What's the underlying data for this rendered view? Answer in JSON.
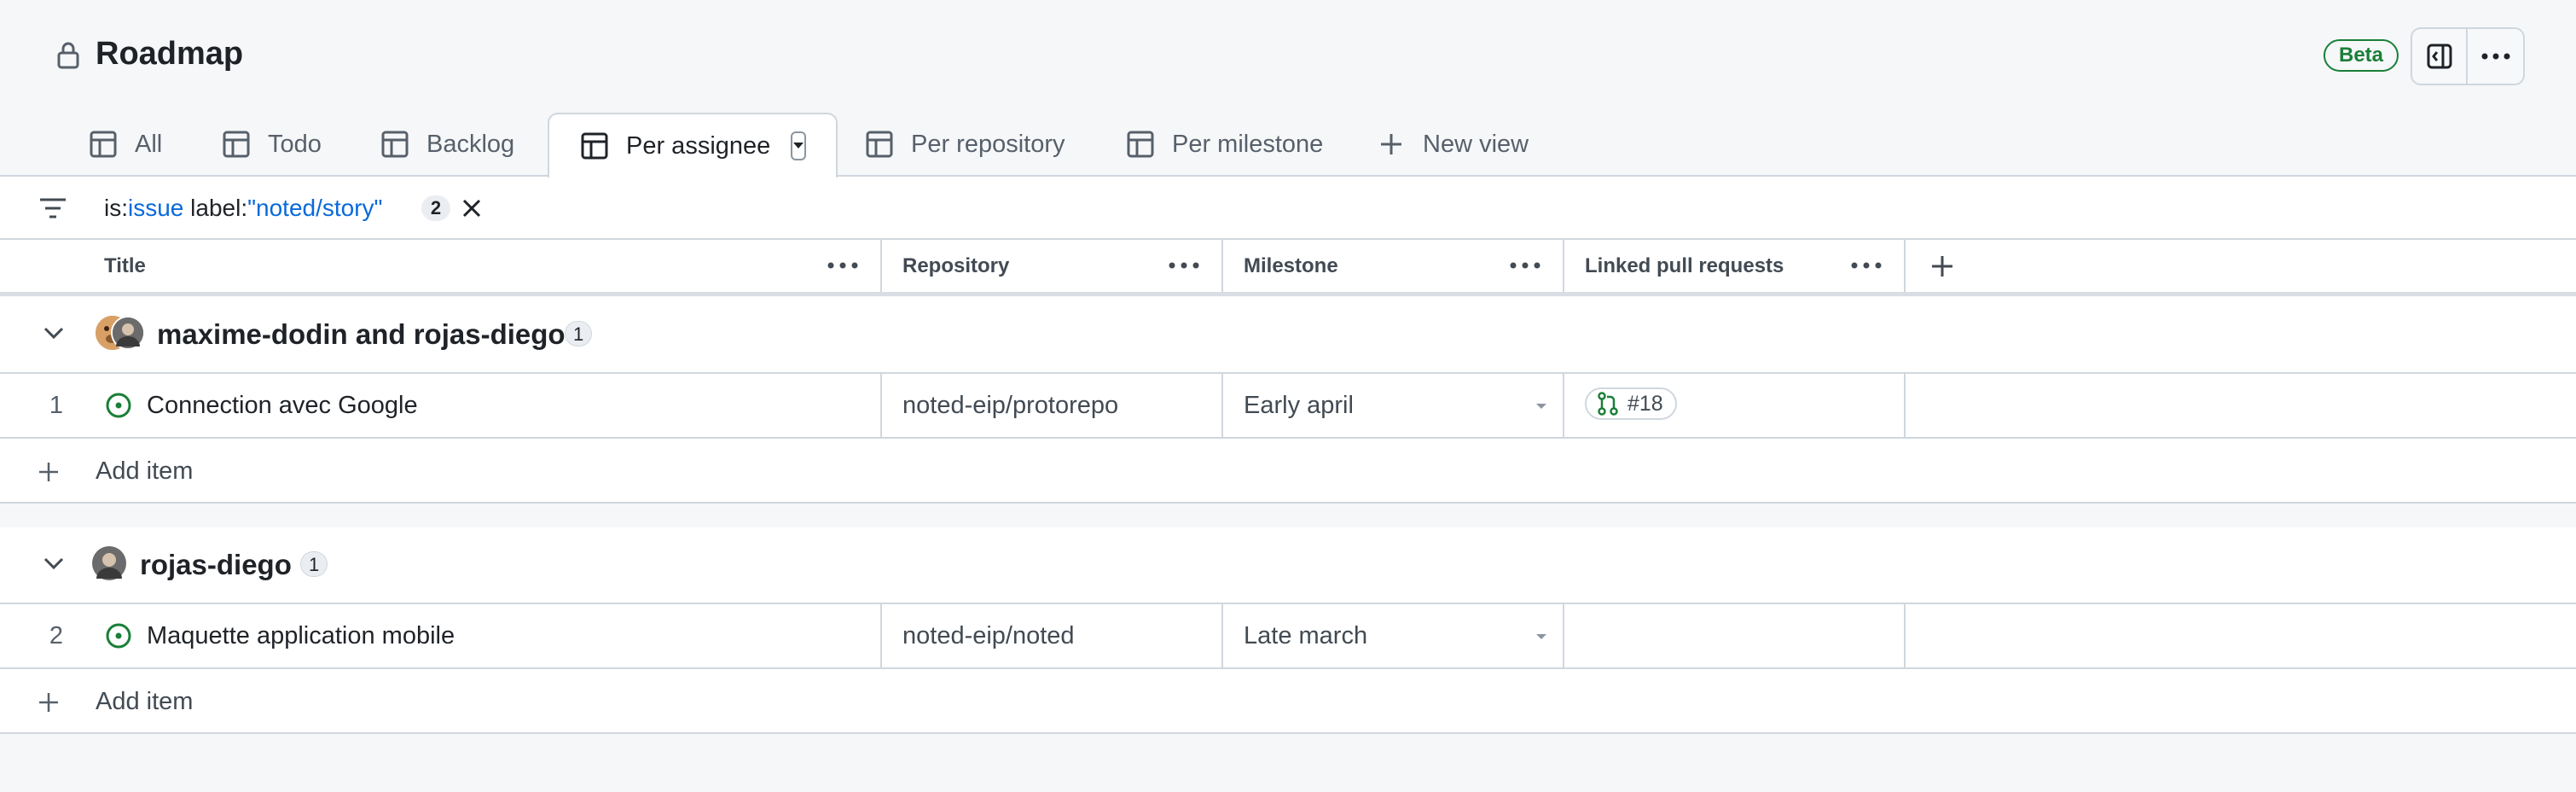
{
  "header": {
    "title": "Roadmap",
    "badge": "Beta",
    "icons": [
      "lock-icon",
      "sidebar-collapse-icon",
      "kebab-icon"
    ]
  },
  "tabs": [
    {
      "label": "All",
      "icon": "table-icon",
      "active": false
    },
    {
      "label": "Todo",
      "icon": "table-icon",
      "active": false
    },
    {
      "label": "Backlog",
      "icon": "table-icon",
      "active": false
    },
    {
      "label": "Per assignee",
      "icon": "table-icon",
      "active": true
    },
    {
      "label": "Per repository",
      "icon": "table-icon",
      "active": false
    },
    {
      "label": "Per milestone",
      "icon": "table-icon",
      "active": false
    },
    {
      "label": "New view",
      "icon": "plus-icon",
      "active": false
    }
  ],
  "filter": {
    "kw1": "is:",
    "val1": "issue",
    "kw2": " label:",
    "val2": "\"noted/story\"",
    "count": "2"
  },
  "columns": [
    {
      "label": "Title"
    },
    {
      "label": "Repository"
    },
    {
      "label": "Milestone"
    },
    {
      "label": "Linked pull requests"
    }
  ],
  "groups": [
    {
      "name": "maxime-dodin and rojas-diego",
      "count": "1",
      "rows": [
        {
          "number": "1",
          "title": "Connection avec Google",
          "repository": "noted-eip/protorepo",
          "milestone": "Early april",
          "pull_request": "#18"
        }
      ],
      "add_label": "Add item"
    },
    {
      "name": "rojas-diego",
      "count": "1",
      "rows": [
        {
          "number": "2",
          "title": "Maquette application mobile",
          "repository": "noted-eip/noted",
          "milestone": "Late march",
          "pull_request": ""
        }
      ],
      "add_label": "Add item"
    }
  ],
  "colors": {
    "accent_green": "#1a7f37",
    "link_blue": "#0969da",
    "border": "#d0d7de",
    "background": "#f6f7f9"
  }
}
